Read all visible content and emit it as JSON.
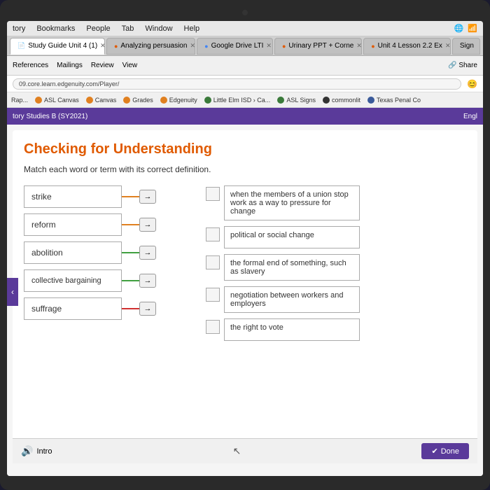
{
  "laptop": {
    "webcam": "webcam-dot"
  },
  "menu_bar": {
    "items": [
      "tory",
      "Bookmarks",
      "People",
      "Tab",
      "Window",
      "Help"
    ]
  },
  "tabs": [
    {
      "label": "Study Guide Unit 4 (1)",
      "active": true,
      "icon": "doc"
    },
    {
      "label": "Analyzing persuasion",
      "active": false,
      "icon": "orange-circle"
    },
    {
      "label": "Google Drive LTI",
      "active": false,
      "icon": "drive"
    },
    {
      "label": "Urinary PPT + Corne",
      "active": false,
      "icon": "orange-circle"
    },
    {
      "label": "Unit 4 Lesson 2.2 Ex",
      "active": false,
      "icon": "orange-circle"
    },
    {
      "label": "Sign",
      "active": false,
      "icon": ""
    }
  ],
  "url_bar": {
    "url": "09.core.learn.edgenuity.com/Player/"
  },
  "bookmarks": [
    {
      "label": "Rap...",
      "type": "plain"
    },
    {
      "label": "ASL Canvas",
      "type": "dot"
    },
    {
      "label": "Canvas",
      "type": "dot"
    },
    {
      "label": "Grades",
      "type": "dot"
    },
    {
      "label": "Edgenuity",
      "type": "dot"
    },
    {
      "label": "Little Elm ISD › Ca...",
      "type": "dot"
    },
    {
      "label": "ASL Signs",
      "type": "dot"
    },
    {
      "label": "commonlit",
      "type": "dot"
    },
    {
      "label": "Texas Penal Co",
      "type": "dot"
    }
  ],
  "ribbon": {
    "tabs": [
      "References",
      "Mailings",
      "Review",
      "View"
    ],
    "share_label": "Share"
  },
  "edgenuity": {
    "course": "tory Studies B (SY2021)",
    "lang": "Engl"
  },
  "page": {
    "title": "Checking for Understanding",
    "subtitle": "Match each word or term with its correct definition.",
    "terms": [
      {
        "id": "strike",
        "label": "strike",
        "line_color": "orange"
      },
      {
        "id": "reform",
        "label": "reform",
        "line_color": "orange"
      },
      {
        "id": "abolition",
        "label": "abolition",
        "line_color": "green"
      },
      {
        "id": "collective_bargaining",
        "label": "collective bargaining",
        "line_color": "green"
      },
      {
        "id": "suffrage",
        "label": "suffrage",
        "line_color": "red"
      }
    ],
    "definitions": [
      {
        "id": "def1",
        "text": "when the members of a union stop work as a way to pressure for change"
      },
      {
        "id": "def2",
        "text": "political or social change"
      },
      {
        "id": "def3",
        "text": "the formal end of something, such as slavery"
      },
      {
        "id": "def4",
        "text": "negotiation between workers and employers"
      },
      {
        "id": "def5",
        "text": "the right to vote"
      }
    ],
    "bottom": {
      "intro_label": "Intro",
      "done_label": "Done"
    }
  }
}
